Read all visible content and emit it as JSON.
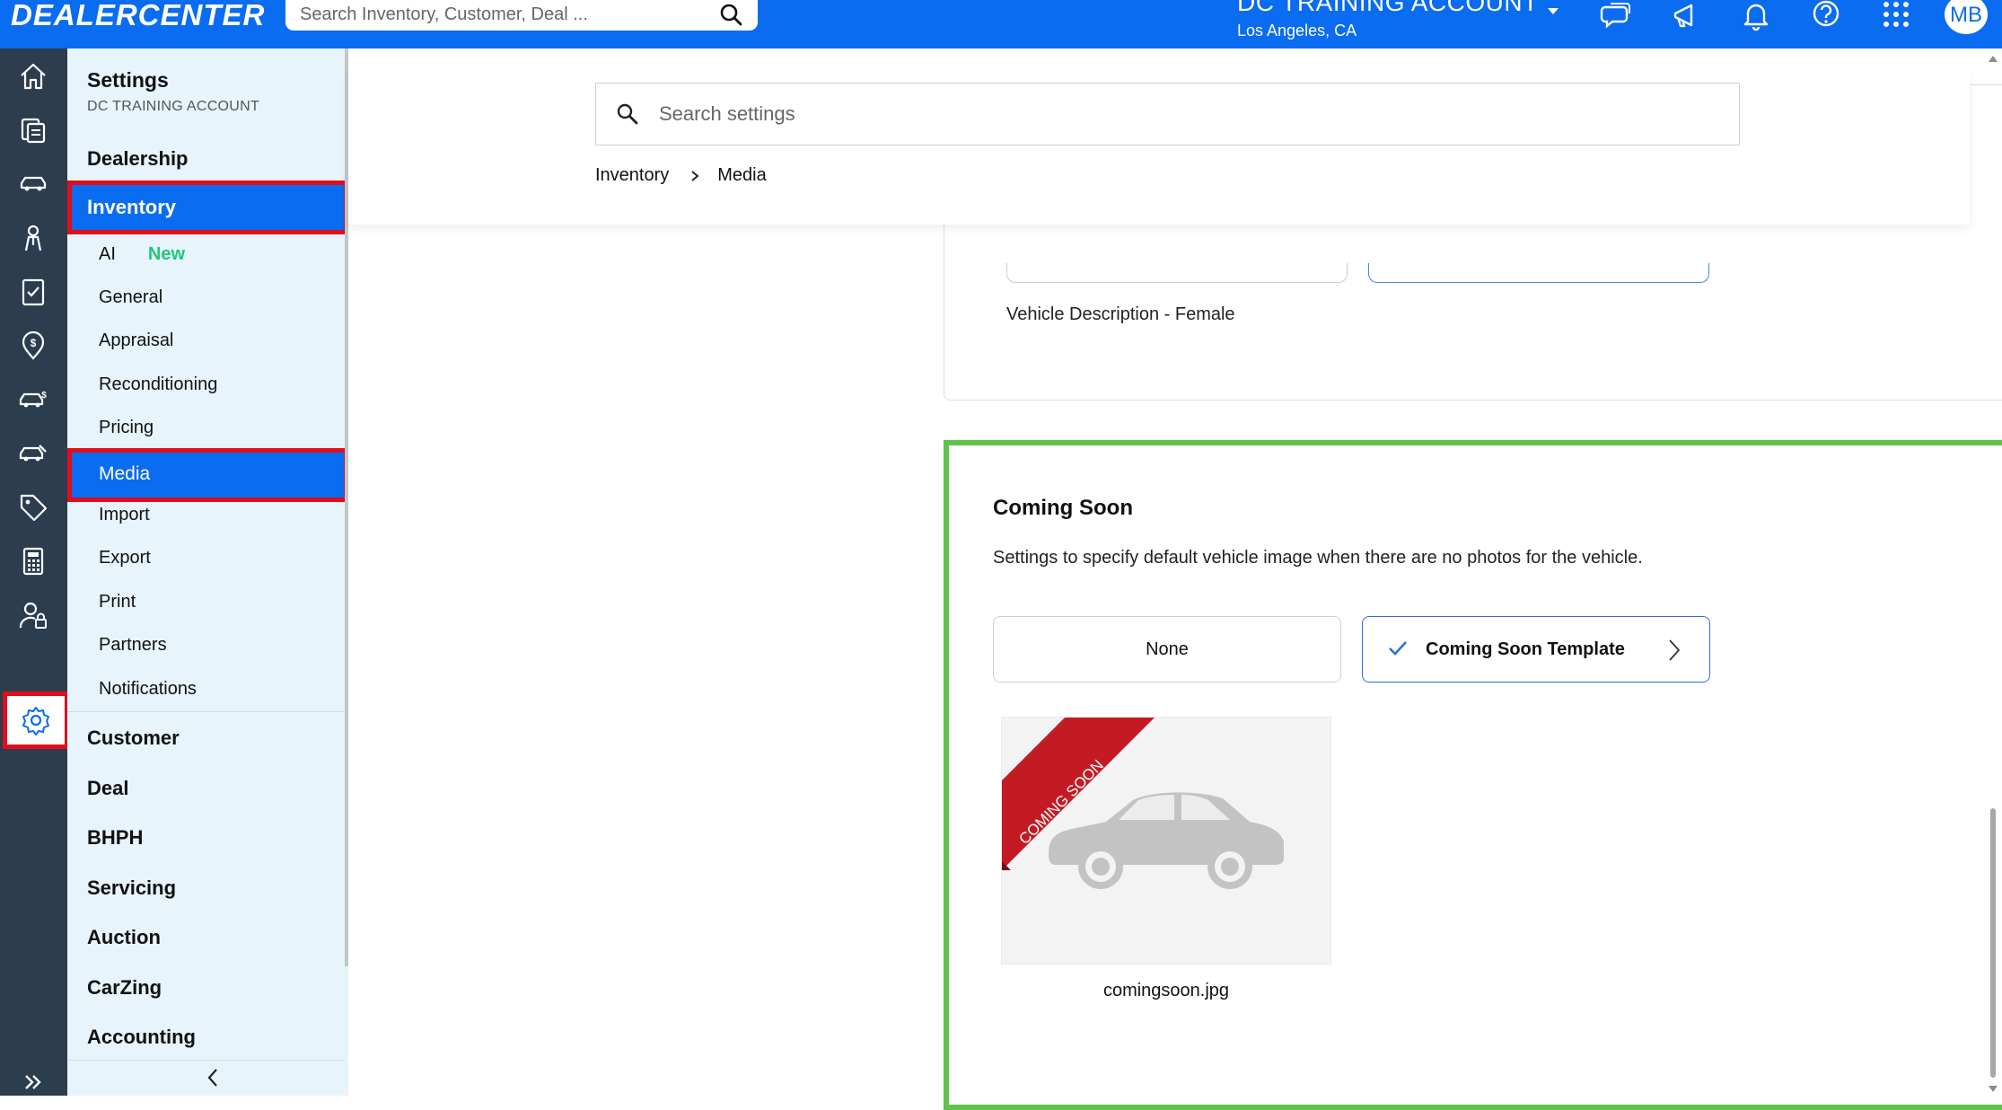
{
  "topbar": {
    "logo": "DEALERCENTER",
    "search_placeholder": "Search Inventory, Customer, Deal ...",
    "account_name": "DC TRAINING ACCOUNT",
    "account_location": "Los Angeles, CA",
    "avatar_initials": "MB",
    "icons": [
      "chat-icon",
      "megaphone-icon",
      "bell-icon",
      "help-icon",
      "apps-grid-icon"
    ]
  },
  "rail": {
    "icons": [
      "home-icon",
      "documents-icon",
      "car-icon",
      "person-icon",
      "checklist-icon",
      "dollar-pin-icon",
      "car-dollar-icon",
      "car-wrench-icon",
      "tag-icon",
      "calculator-icon",
      "user-lock-icon",
      "gear-icon"
    ],
    "active": "gear-icon"
  },
  "sidebar": {
    "title": "Settings",
    "subtitle": "DC TRAINING ACCOUNT",
    "categories": {
      "dealership": "Dealership",
      "inventory": "Inventory",
      "customer": "Customer",
      "deal": "Deal",
      "bhph": "BHPH",
      "servicing": "Servicing",
      "auction": "Auction",
      "carzing": "CarZing",
      "accounting": "Accounting"
    },
    "inventory_items": {
      "ai": "AI",
      "ai_badge": "New",
      "general": "General",
      "appraisal": "Appraisal",
      "reconditioning": "Reconditioning",
      "pricing": "Pricing",
      "media": "Media",
      "import": "Import",
      "export": "Export",
      "print": "Print",
      "partners": "Partners",
      "notifications": "Notifications"
    }
  },
  "settings_search": {
    "placeholder": "Search settings"
  },
  "breadcrumb": {
    "parent": "Inventory",
    "current": "Media"
  },
  "previous_section": {
    "description_label": "Vehicle Description - Female"
  },
  "coming_soon": {
    "title": "Coming Soon",
    "description": "Settings to specify default vehicle image when there are no photos for the vehicle.",
    "options": {
      "none": "None",
      "template": "Coming Soon Template"
    },
    "selected": "Coming Soon Template",
    "image_ribbon": "COMING SOON",
    "image_filename": "comingsoon.jpg"
  },
  "colors": {
    "brand_blue": "#0a6cf0",
    "rail": "#2b3d4f",
    "sidebar_bg": "#e7f4fb",
    "highlight_red": "#e10d1a",
    "highlight_green": "#5fc44a",
    "badge_green": "#1fc87a"
  }
}
